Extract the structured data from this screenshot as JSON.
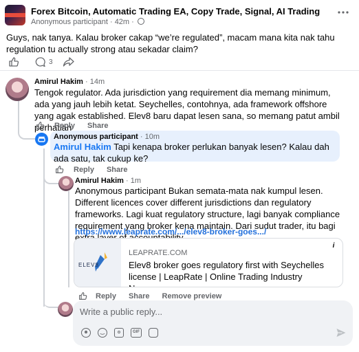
{
  "post": {
    "group_name": "Forex Bitcoin, Automatic Trading EA, Copy Trade, Signal, AI Trading",
    "author": "Anonymous participant",
    "time": "42m",
    "body": "Guys, nak tanya. Kalau broker cakap “we’re regulated”, macam mana kita nak tahu regulation tu actually strong atau sekadar claim?",
    "comment_count": "3",
    "icons": [
      "like-icon",
      "comment-icon",
      "share-icon",
      "more-icon",
      "globe-icon"
    ]
  },
  "comments": [
    {
      "author": "Amirul Hakim",
      "time": "14m",
      "text": "Tengok regulator. Ada jurisdiction yang requirement dia memang minimum, ada yang jauh lebih ketat. Seychelles, contohnya, ada framework offshore yang agak established. Elev8 baru dapat lesen sana, so memang patut ambil perhatian",
      "reply_label": "Reply",
      "share_label": "Share"
    },
    {
      "author": "Anonymous participant",
      "time": "10m",
      "mention": "Amirul Hakim",
      "text": "Tapi kenapa broker perlukan banyak lesen? Kalau dah ada satu, tak cukup ke?",
      "reply_label": "Reply",
      "share_label": "Share"
    },
    {
      "author": "Amirul Hakim",
      "time": "1m",
      "text": "Anonymous participant Bukan semata-mata nak kumpul lesen. Different licences cover different jurisdictions dan regulatory frameworks. Lagi kuat regulatory structure, lagi banyak compliance requirement yang broker kena maintain. Dari sudut trader, itu bagi extra layer of accountability.",
      "link": "https://www.leaprate.com/.../elev8-broker-goes.../",
      "preview": {
        "domain": "LEAPRATE.COM",
        "title": "Elev8 broker goes regulatory first with Seychelles license | LeapRate | Online Trading Industry News,...",
        "logo_text": "ELEV8"
      },
      "reply_label": "Reply",
      "share_label": "Share",
      "remove_preview_label": "Remove preview"
    }
  ],
  "composer": {
    "placeholder": "Write a public reply...",
    "gif_label": "GIF",
    "tools": [
      "avatar-sticker-icon",
      "emoji-icon",
      "camera-icon",
      "gif-icon",
      "sticker-icon",
      "send-icon"
    ]
  },
  "colors": {
    "accent": "#1877f2",
    "secondary_text": "#65676b",
    "bubble": "#e7f0fd",
    "composer_bg": "#f0f2f5"
  }
}
